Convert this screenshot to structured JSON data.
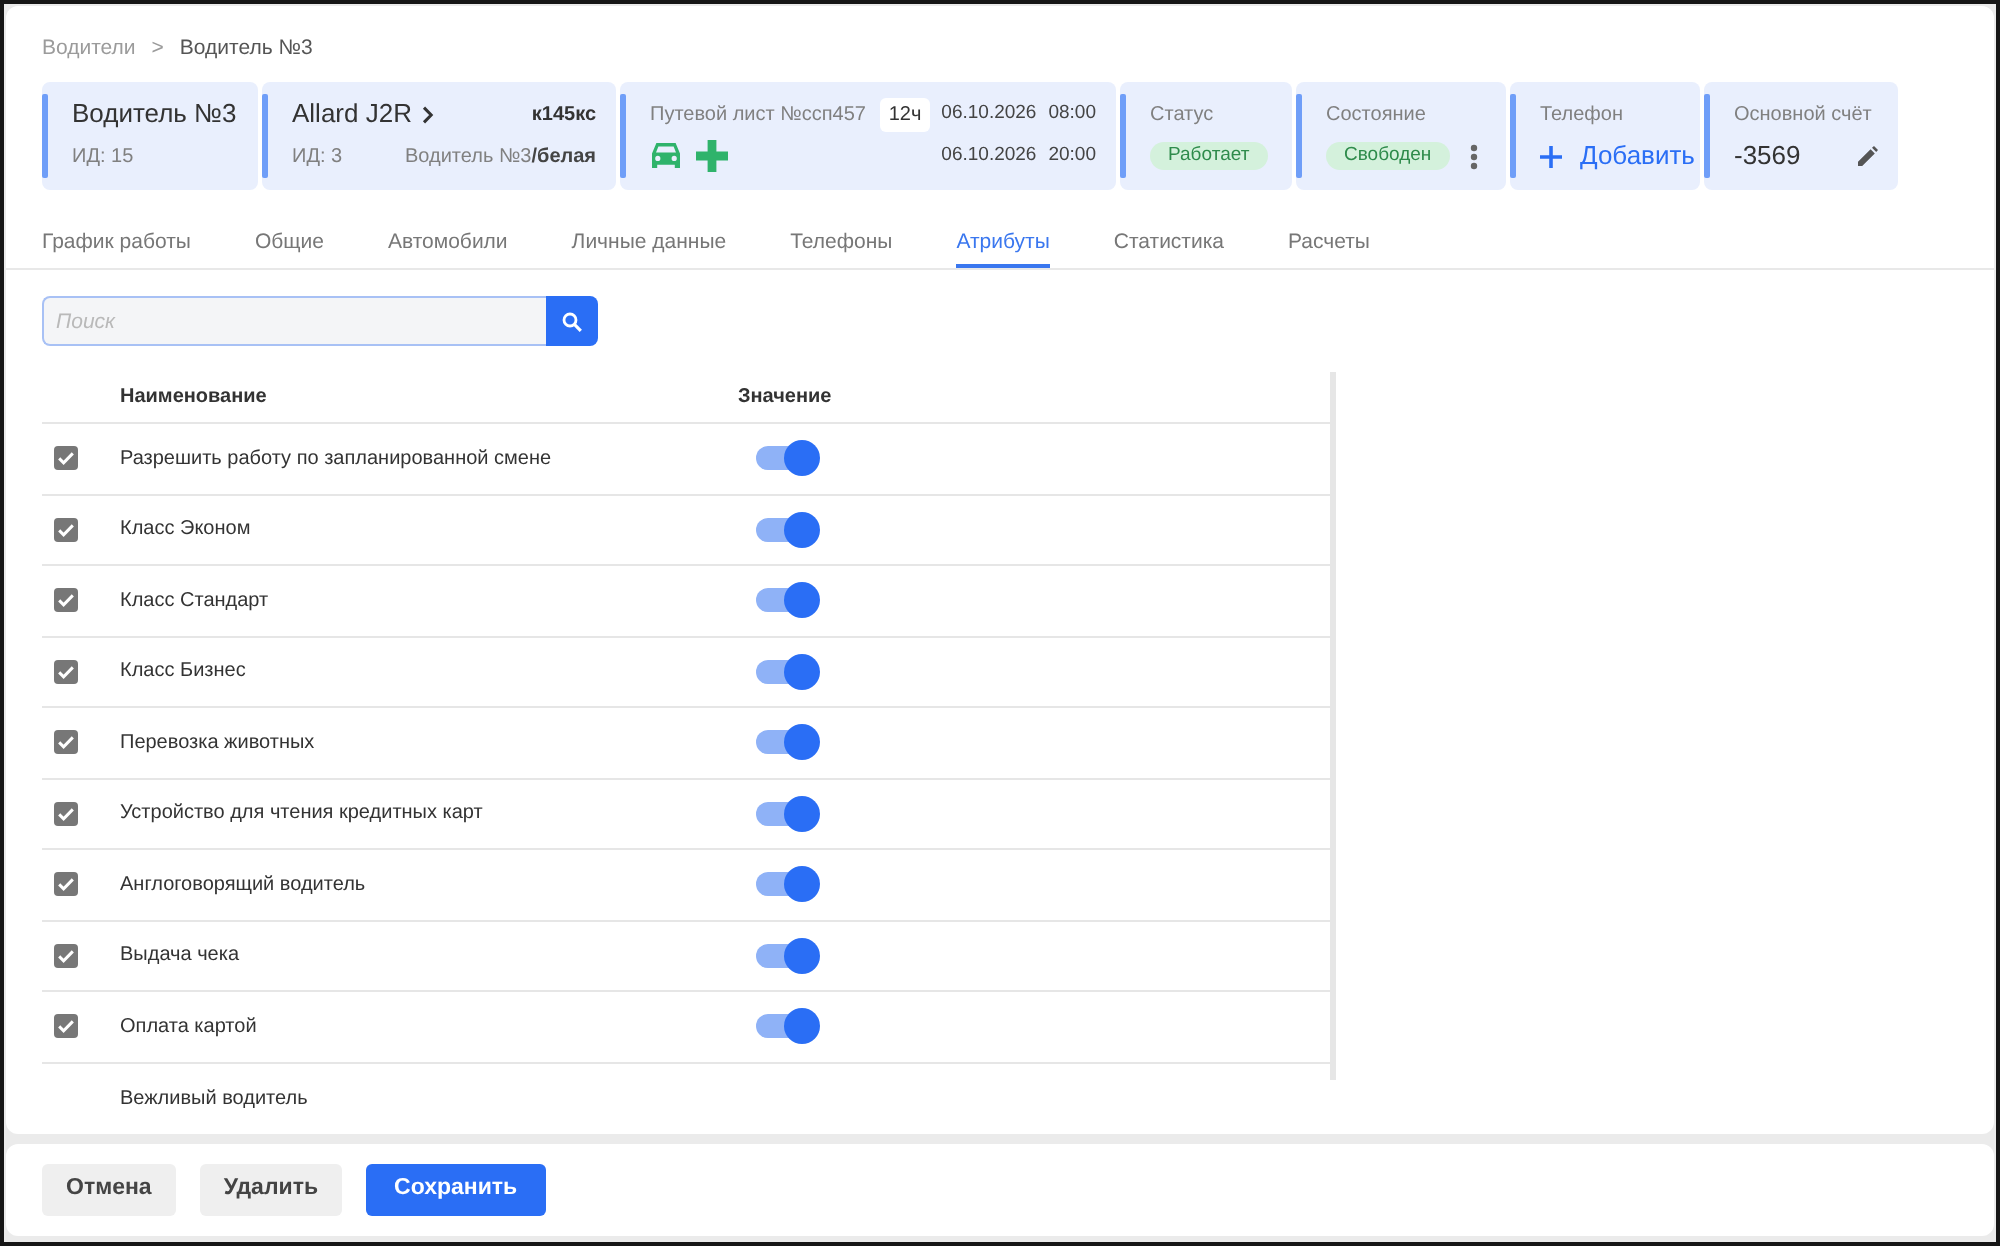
{
  "breadcrumbs": {
    "items": [
      {
        "label": "Водители"
      },
      {
        "label": "Водитель №3"
      }
    ],
    "separator": ">"
  },
  "header_cards": [
    {
      "kind": "driver",
      "title": "Водитель №3",
      "id_label": "ИД: 15"
    },
    {
      "kind": "car",
      "title": "Allard J2R",
      "plate": "к145кс",
      "id_label": "ИД: 3",
      "assignment": "Водитель №3**/белая**"
    },
    {
      "kind": "waybill",
      "title": "Путевой лист №ссп457",
      "duration": "12ч",
      "start_date": "06.10.2026",
      "start_time": "08:00",
      "end_date": "06.10.2026",
      "end_time": "20:00"
    },
    {
      "kind": "status",
      "label": "Статус",
      "value": "Работает"
    },
    {
      "kind": "state",
      "label": "Состояние",
      "value": "Свободен"
    },
    {
      "kind": "phone",
      "label": "Телефон",
      "action": "Добавить"
    },
    {
      "kind": "account",
      "label": "Основной счёт",
      "value": "-3569"
    }
  ],
  "tabs": [
    {
      "label": "График работы",
      "selected": false
    },
    {
      "label": "Общие",
      "selected": false
    },
    {
      "label": "Автомобили",
      "selected": false
    },
    {
      "label": "Личные данные",
      "selected": false
    },
    {
      "label": "Телефоны",
      "selected": false
    },
    {
      "label": "Атрибуты",
      "selected": true
    },
    {
      "label": "Статистика",
      "selected": false
    },
    {
      "label": "Расчеты",
      "selected": false
    }
  ],
  "search": {
    "placeholder": "Поиск"
  },
  "table": {
    "columns": [
      "Наименование",
      "Значение"
    ],
    "rows": [
      {
        "kind": "toggle",
        "name": "Разрешить работу по запланированной смене",
        "checked": true,
        "on": true
      },
      {
        "kind": "toggle",
        "name": "Класс Эконом",
        "checked": true,
        "on": true
      },
      {
        "kind": "toggle",
        "name": "Класс Стандарт",
        "checked": true,
        "on": true
      },
      {
        "kind": "toggle",
        "name": "Класс Бизнес",
        "checked": true,
        "on": true
      },
      {
        "kind": "toggle",
        "name": "Перевозка животных",
        "checked": true,
        "on": true
      },
      {
        "kind": "toggle",
        "name": "Устройство для чтения кредитных карт",
        "checked": true,
        "on": true
      },
      {
        "kind": "toggle",
        "name": "Англоговорящий водитель",
        "checked": true,
        "on": true
      },
      {
        "kind": "toggle",
        "name": "Выдача чека",
        "checked": true,
        "on": true
      },
      {
        "kind": "toggle",
        "name": "Оплата картой",
        "checked": true,
        "on": true
      },
      {
        "kind": "label",
        "name": "Вежливый водитель"
      }
    ]
  },
  "footer_buttons": [
    {
      "label": "Отмена",
      "kind": "secondary"
    },
    {
      "label": "Удалить",
      "kind": "secondary"
    },
    {
      "label": "Сохранить",
      "kind": "primary"
    }
  ]
}
